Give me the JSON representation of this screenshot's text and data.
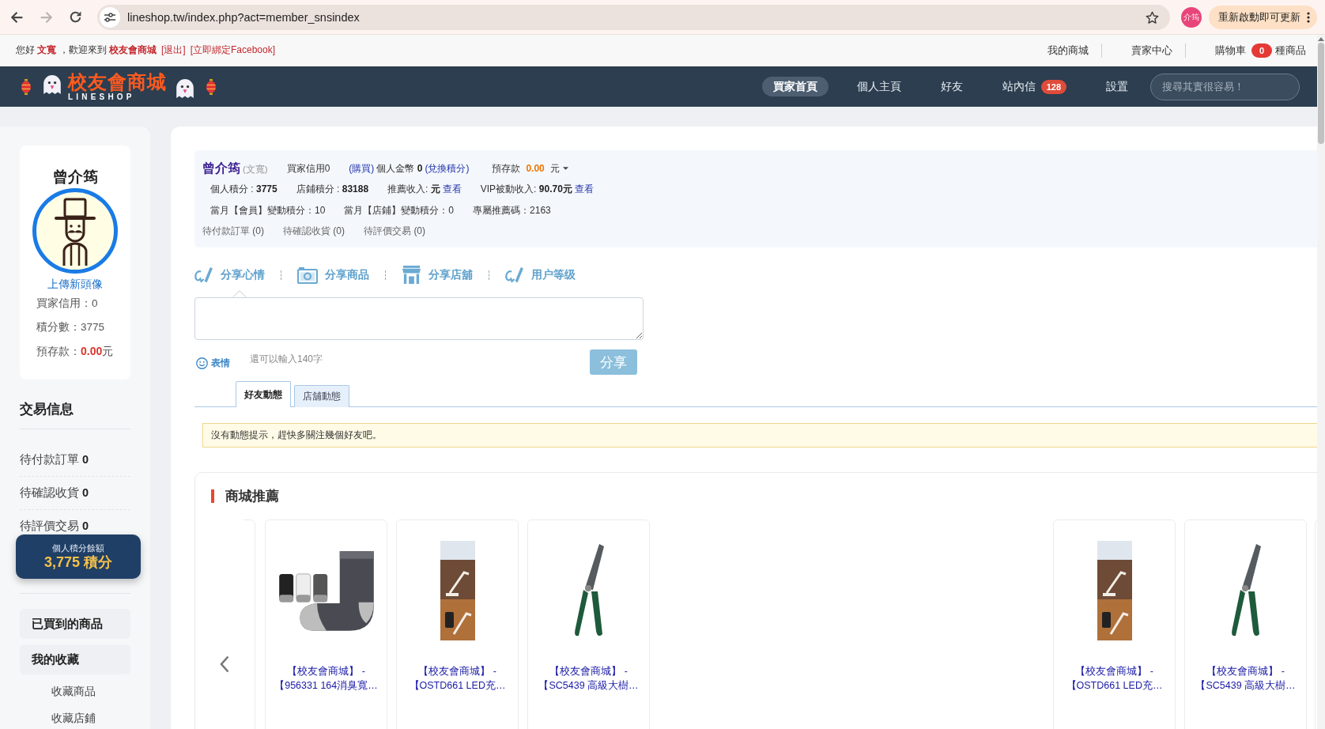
{
  "browser": {
    "nav_buttons": [
      {
        "kind": "back",
        "disabled": false
      },
      {
        "kind": "forward",
        "disabled": true
      },
      {
        "kind": "reload",
        "disabled": false
      }
    ],
    "url": "lineshop.tw/index.php?act=member_snsindex",
    "profile": "介筠",
    "update_button": "重新啟動即可更新"
  },
  "topbar": {
    "greeting": "您好 **文寬** ，歡迎來到 **校友會商城**",
    "links": [
      "[退出]",
      "[立即綁定Facebook]"
    ],
    "menu": [
      "我的商城",
      "賣家中心"
    ],
    "cart": {
      "label": "購物車",
      "count": "0",
      "suffix": "種商品"
    }
  },
  "navbar": {
    "logo": {
      "title": "校友會商城",
      "subtitle": "LINESHOP"
    },
    "items": [
      {
        "label": "買家首頁",
        "selected": true
      },
      {
        "label": "個人主頁",
        "selected": false
      },
      {
        "label": "好友",
        "selected": false
      },
      {
        "label": "站內信",
        "selected": false,
        "badge": "128"
      },
      {
        "label": "設置",
        "selected": false
      }
    ],
    "search": {
      "placeholder": "搜尋其實很容易！"
    }
  },
  "sidebar": {
    "profile": {
      "name": "曾介筠",
      "upload_link": "上傳新頭像",
      "stats": [
        "買家信用：0",
        "積分數：3775",
        "預存款：**0.00**元"
      ]
    },
    "trade_info": {
      "title": "交易信息",
      "items": [
        "待付款訂單 **0**",
        "待確認收貨 **0**",
        "待評價交易 **0**"
      ]
    },
    "points_badge": {
      "label": "個人積分餘額",
      "value": "3,775 積分"
    },
    "actions": [
      {
        "label": "已買到的商品"
      },
      {
        "label": "我的收藏",
        "children": [
          {
            "label": "收藏商品"
          },
          {
            "label": "收藏店鋪"
          }
        ]
      }
    ]
  },
  "account": {
    "rows": [
      {
        "kind": "header",
        "items": [
          [
            {
              "kind": "name",
              "text": "曾介筠"
            },
            {
              "kind": "muted",
              "text": "(文寬)"
            }
          ],
          [
            {
              "kind": "text",
              "text": "買家信用0"
            }
          ],
          [
            {
              "kind": "link",
              "text": "(購買)"
            },
            {
              "kind": "text",
              "text": "個人金幣 **0**"
            },
            {
              "kind": "link",
              "text": "(兌換積分)"
            }
          ],
          [
            {
              "kind": "dropdown",
              "text": "預存款 **0.00** 元"
            }
          ]
        ]
      },
      {
        "kind": "stats",
        "items": [
          [
            {
              "kind": "text",
              "text": "個人積分 : **3775**"
            }
          ],
          [
            {
              "kind": "text",
              "text": "店鋪積分 : **83188**"
            }
          ],
          [
            {
              "kind": "text",
              "text": "推薦收入: **元**"
            },
            {
              "kind": "link",
              "text": "查看"
            }
          ],
          [
            {
              "kind": "text",
              "text": "VIP被動收入: **90.70元**"
            },
            {
              "kind": "link",
              "text": "查看"
            }
          ]
        ]
      },
      {
        "kind": "stats",
        "items": [
          [
            {
              "kind": "text",
              "text": "當月【會員】變動積分：10"
            }
          ],
          [
            {
              "kind": "text",
              "text": "當月【店鋪】變動積分：0"
            }
          ],
          [
            {
              "kind": "text",
              "text": "專屬推薦碼：2163"
            }
          ]
        ]
      },
      {
        "kind": "pending",
        "items": [
          [
            {
              "kind": "text",
              "text": "待付款訂單 **(0)**"
            }
          ],
          [
            {
              "kind": "text",
              "text": "待確認收貨 **(0)**"
            }
          ],
          [
            {
              "kind": "text",
              "text": "待評價交易 **(0)**"
            }
          ]
        ]
      }
    ]
  },
  "share": {
    "tabs": [
      {
        "kind": "mood",
        "label": "分享心情",
        "selected": true
      },
      {
        "kind": "product",
        "label": "分享商品",
        "selected": false
      },
      {
        "kind": "store",
        "label": "分享店舖",
        "selected": false
      },
      {
        "kind": "level",
        "label": "用户等级",
        "selected": false
      }
    ],
    "emoji": "表情",
    "counter": "還可以輸入140字",
    "submit": "分享"
  },
  "feed": {
    "tabs": [
      {
        "label": "好友動態",
        "selected": true
      },
      {
        "label": "店舖動態",
        "selected": false
      }
    ],
    "notice": "沒有動態提示，趕快多關注幾個好友吧。"
  },
  "recommend": {
    "title": "商城推薦",
    "products": [
      {
        "kind": "socks",
        "title": "【校友會商城】 -\n【956331 164消臭寬…"
      },
      {
        "kind": "lamp",
        "title": "【校友會商城】 -\n【OSTD661 LED充…"
      },
      {
        "kind": "shears",
        "title": "【校友會商城】 -\n【SC5439 高級大樹…"
      },
      {
        "kind": "lamp",
        "title": "【校友會商城】 -\n【OSTD661 LED充…"
      },
      {
        "kind": "shears",
        "title": "【校友會商城】 -\n【SC5439 高級大樹…"
      }
    ]
  }
}
